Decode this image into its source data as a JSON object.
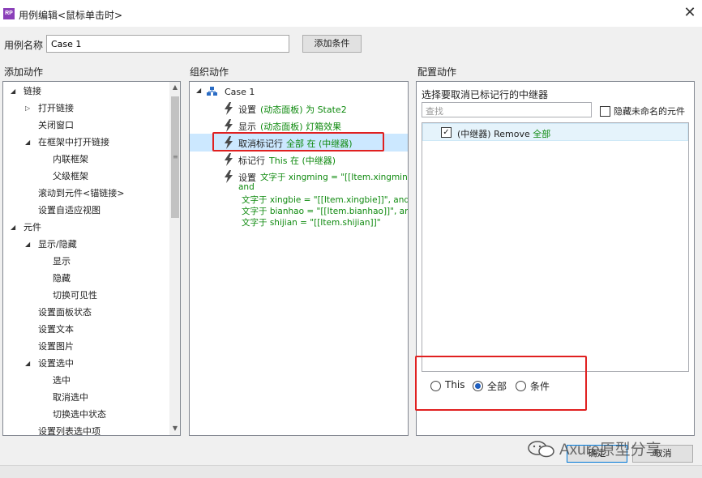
{
  "window": {
    "app_icon_text": "RP",
    "title": "用例编辑<鼠标单击时>",
    "close_glyph": "✕"
  },
  "case": {
    "label": "用例名称",
    "value": "Case 1",
    "add_condition": "添加条件"
  },
  "sections": {
    "add_action": "添加动作",
    "organize_action": "组织动作",
    "configure_action": "配置动作"
  },
  "add_tree": [
    {
      "label": "链接",
      "expander": "◢"
    },
    {
      "label": "打开链接",
      "expander": "▷"
    },
    {
      "label": "关闭窗口",
      "expander": ""
    },
    {
      "label": "在框架中打开链接",
      "expander": "◢"
    },
    {
      "label": "内联框架",
      "expander": ""
    },
    {
      "label": "父级框架",
      "expander": ""
    },
    {
      "label": "滚动到元件<锚链接>",
      "expander": ""
    },
    {
      "label": "设置自适应视图",
      "expander": ""
    },
    {
      "label": "元件",
      "expander": "◢"
    },
    {
      "label": "显示/隐藏",
      "expander": "◢"
    },
    {
      "label": "显示",
      "expander": ""
    },
    {
      "label": "隐藏",
      "expander": ""
    },
    {
      "label": "切换可见性",
      "expander": ""
    },
    {
      "label": "设置面板状态",
      "expander": ""
    },
    {
      "label": "设置文本",
      "expander": ""
    },
    {
      "label": "设置图片",
      "expander": ""
    },
    {
      "label": "设置选中",
      "expander": "◢"
    },
    {
      "label": "选中",
      "expander": ""
    },
    {
      "label": "取消选中",
      "expander": ""
    },
    {
      "label": "切换选中状态",
      "expander": ""
    },
    {
      "label": "设置列表选中项",
      "expander": ""
    }
  ],
  "organize": {
    "case_name": "Case 1",
    "actions": [
      {
        "verb": "设置",
        "detail": "(动态面板) 为 State2"
      },
      {
        "verb": "显示",
        "detail": "(动态面板) 灯箱效果"
      },
      {
        "verb": "取消标记行",
        "detail": "全部 在 (中继器)"
      },
      {
        "verb": "标记行",
        "detail": "This 在 (中继器)"
      }
    ],
    "set_text": {
      "verb": "设置",
      "line1": "文字于 xingming = \"[[Item.xingming]]\",",
      "line2": "and",
      "line3": "文字于 xingbie = \"[[Item.xingbie]]\", and",
      "line4": "文字于 bianhao = \"[[Item.bianhao]]\", and",
      "line5": "文字于 shijian = \"[[Item.shijian]]\""
    }
  },
  "configure": {
    "title": "选择要取消已标记行的中继器",
    "search_placeholder": "查找",
    "hide_unnamed": "隐藏未命名的元件",
    "item_prefix": "(中继器) Remove ",
    "item_highlight": "全部",
    "item_checked": true,
    "radio_options": [
      {
        "label": "This",
        "selected": false
      },
      {
        "label": "全部",
        "selected": true
      },
      {
        "label": "条件",
        "selected": false
      }
    ]
  },
  "footer": {
    "ok": "确定",
    "cancel": "取消",
    "watermark": "Axure原型分享"
  },
  "colors": {
    "green_text": "#0f8a0f",
    "selected_row": "#cce8ff",
    "highlight_box": "#e02020",
    "accent_icon": "#8a3fb8"
  }
}
